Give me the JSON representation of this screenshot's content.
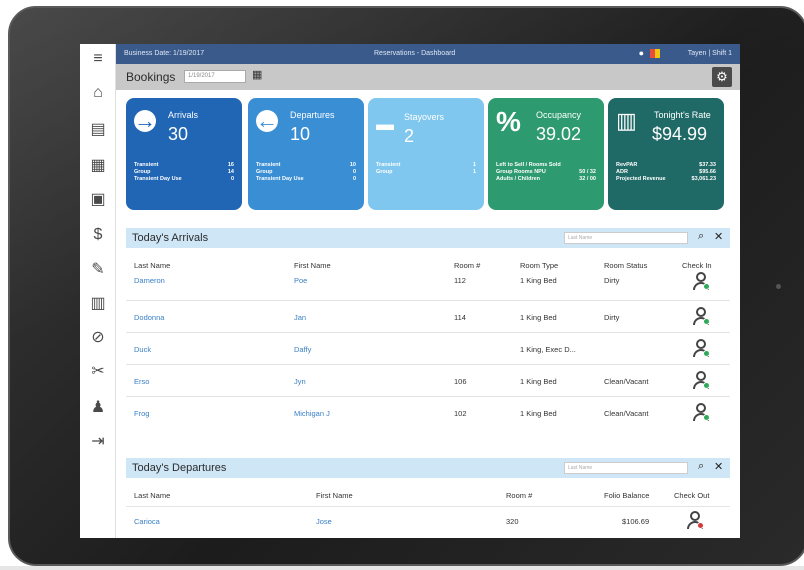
{
  "topbar": {
    "business_date": "Business Date: 1/19/2017",
    "title": "Reservations - Dashboard",
    "user": "Tayen | Shift 1"
  },
  "bookings": {
    "title": "Bookings",
    "date": "1/19/2017"
  },
  "nav": [
    {
      "icon": "hamburger-menu-icon",
      "glyph": "≡"
    },
    {
      "icon": "home-icon",
      "glyph": "⌂"
    },
    {
      "icon": "document-icon",
      "glyph": "▤"
    },
    {
      "icon": "building-icon",
      "glyph": "▦"
    },
    {
      "icon": "calendar-icon",
      "glyph": "▣"
    },
    {
      "icon": "money-icon",
      "glyph": "$"
    },
    {
      "icon": "broom-icon",
      "glyph": "✎"
    },
    {
      "icon": "clipboard-icon",
      "glyph": "▥"
    },
    {
      "icon": "ban-icon",
      "glyph": "⊘"
    },
    {
      "icon": "wrench-icon",
      "glyph": "✂"
    },
    {
      "icon": "users-icon",
      "glyph": "♟"
    },
    {
      "icon": "sign-out-icon",
      "glyph": "⇥"
    }
  ],
  "cards": {
    "arrivals": {
      "title": "Arrivals",
      "value": "30",
      "rows": [
        [
          "Transient",
          "16"
        ],
        [
          "Group",
          "14"
        ],
        [
          "Transient Day Use",
          "0"
        ]
      ]
    },
    "departures": {
      "title": "Departures",
      "value": "10",
      "rows": [
        [
          "Transient",
          "10"
        ],
        [
          "Group",
          "0"
        ],
        [
          "Transient Day Use",
          "0"
        ]
      ]
    },
    "stayovers": {
      "title": "Stayovers",
      "value": "2",
      "rows": [
        [
          "Transient",
          "1"
        ],
        [
          "Group",
          "1"
        ]
      ]
    },
    "occupancy": {
      "title": "Occupancy",
      "value": "39.02",
      "rows": [
        [
          "Left to Sell / Rooms Sold",
          ""
        ],
        [
          "Group Rooms NPU",
          "50 / 32"
        ],
        [
          "Adults / Children",
          "32 / 00"
        ]
      ]
    },
    "rate": {
      "title": "Tonight's Rate",
      "value": "$94.99",
      "rows": [
        [
          "RevPAR",
          "$37.33"
        ],
        [
          "ADR",
          "$95.66"
        ],
        [
          "Projected Revenue",
          "$3,061.23"
        ]
      ]
    }
  },
  "arrivals": {
    "title": "Today's Arrivals",
    "search_placeholder": "Last Name",
    "columns": [
      "Last Name",
      "First Name",
      "Room #",
      "Room Type",
      "Room Status",
      "Check In"
    ],
    "rows": [
      [
        "Dameron",
        "Poe",
        "112",
        "1 King Bed",
        "Dirty"
      ],
      [
        "Dodonna",
        "Jan",
        "114",
        "1 King Bed",
        "Dirty"
      ],
      [
        "Duck",
        "Daffy",
        "",
        "1 King, Exec D...",
        ""
      ],
      [
        "Erso",
        "Jyn",
        "106",
        "1 King Bed",
        "Clean/Vacant"
      ],
      [
        "Frog",
        "Michigan J",
        "102",
        "1 King Bed",
        "Clean/Vacant"
      ]
    ]
  },
  "departures": {
    "title": "Today's Departures",
    "search_placeholder": "Last Name",
    "columns": [
      "Last Name",
      "First Name",
      "Room #",
      "Folio Balance",
      "Check Out"
    ],
    "rows": [
      [
        "Carioca",
        "Jose",
        "320",
        "$106.69"
      ]
    ]
  }
}
